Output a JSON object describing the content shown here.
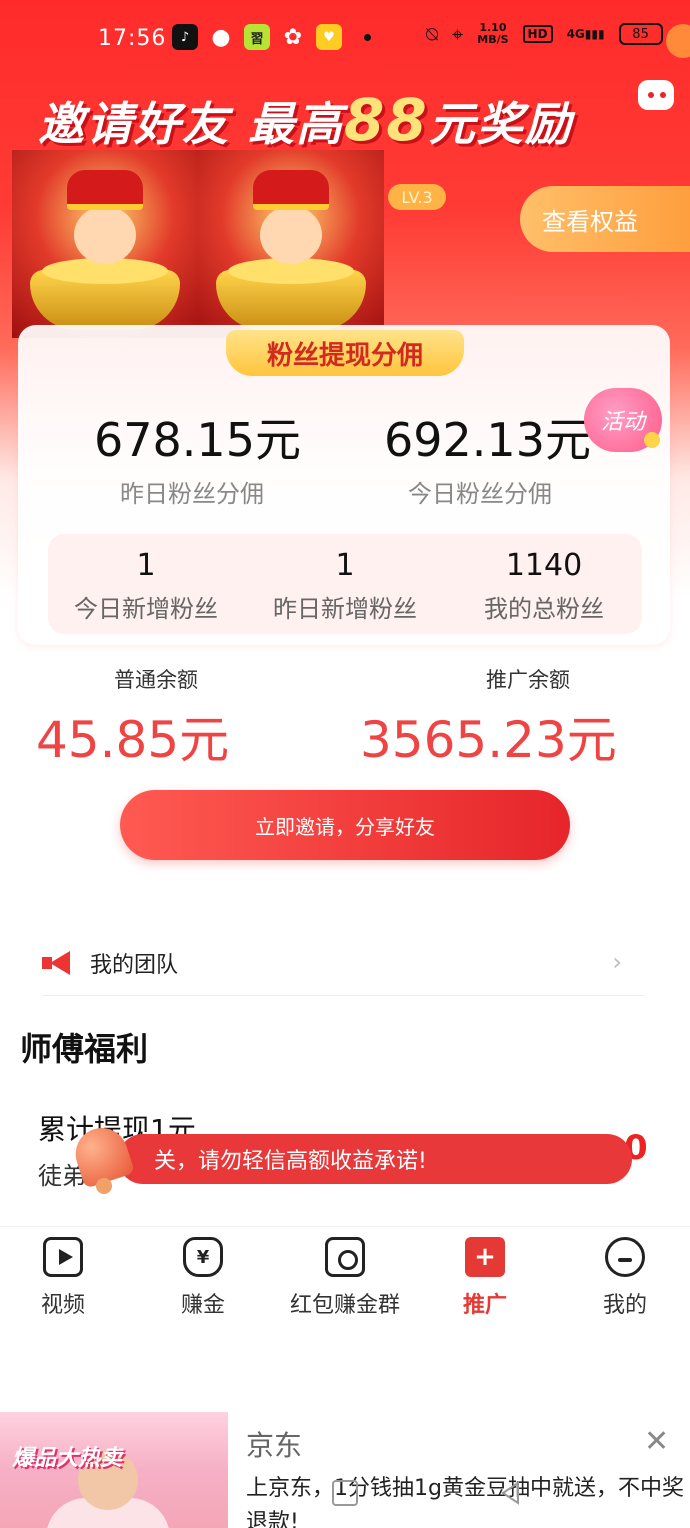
{
  "status_bar": {
    "time": "17:56",
    "speed_value": "1.10",
    "speed_unit": "MB/S",
    "hd": "HD",
    "signal": "4G",
    "battery": "85"
  },
  "banner": {
    "title_part1": "邀请好友",
    "title_part2": "最高",
    "title_num": "88",
    "title_part3": "元奖励"
  },
  "level_badge": "LV.3",
  "rights_button": "查看权益",
  "card": {
    "tab_label": "粉丝提现分佣",
    "activity_badge": "活动",
    "yesterday_commission": "678.15元",
    "yesterday_commission_label": "昨日粉丝分佣",
    "today_commission": "692.13元",
    "today_commission_label": "今日粉丝分佣",
    "fans": [
      {
        "value": "1",
        "label": "今日新增粉丝"
      },
      {
        "value": "1",
        "label": "昨日新增粉丝"
      },
      {
        "value": "1140",
        "label": "我的总粉丝"
      }
    ]
  },
  "balances": {
    "normal_label": "普通余额",
    "normal_value": "45.85元",
    "promo_label": "推广余额",
    "promo_value": "3565.23元"
  },
  "invite_button": "立即邀请，分享好友",
  "team_row": {
    "label": "我的团队"
  },
  "section_title": "师傅福利",
  "welfare": {
    "title": "累计提现1元",
    "subtitle": "徒弟",
    "right_value": "0"
  },
  "toast": "关，请勿轻信高额收益承诺!",
  "tabbar": [
    {
      "label": "视频",
      "icon": "video-icon"
    },
    {
      "label": "赚金",
      "icon": "money-bag-icon",
      "glyph": "¥"
    },
    {
      "label": "红包赚金群",
      "icon": "group-icon"
    },
    {
      "label": "推广",
      "icon": "promote-icon",
      "glyph": "+"
    },
    {
      "label": "我的",
      "icon": "profile-icon"
    }
  ],
  "ad": {
    "brand": "京东",
    "description": "上京东，1分钱抽1g黄金豆抽中就送，不中奖退款!",
    "image_text": "爆品大热卖"
  },
  "colors": {
    "primary_red": "#e53935",
    "balance_red": "#ee4444",
    "gold": "#ffc53d"
  }
}
